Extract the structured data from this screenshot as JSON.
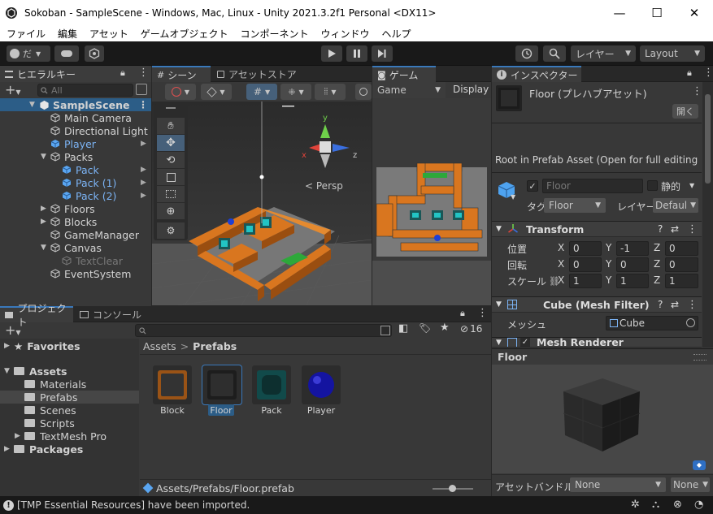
{
  "window": {
    "title": "Sokoban - SampleScene - Windows, Mac, Linux - Unity 2021.3.2f1 Personal <DX11>",
    "minimize": "—",
    "maximize": "☐",
    "close": "✕"
  },
  "menu": [
    "ファイル",
    "編集",
    "アセット",
    "ゲームオブジェクト",
    "コンポーネント",
    "ウィンドウ",
    "ヘルプ"
  ],
  "toolbar": {
    "account": "だ",
    "layers": "レイヤー",
    "layout": "Layout"
  },
  "hierarchy": {
    "tab": "ヒエラルキー",
    "search_placeholder": "All",
    "items": [
      {
        "label": "SampleScene",
        "depth": 0
      },
      {
        "label": "Main Camera",
        "depth": 1
      },
      {
        "label": "Directional Light",
        "depth": 1
      },
      {
        "label": "Player",
        "depth": 1
      },
      {
        "label": "Packs",
        "depth": 1
      },
      {
        "label": "Pack",
        "depth": 2
      },
      {
        "label": "Pack (1)",
        "depth": 2
      },
      {
        "label": "Pack (2)",
        "depth": 2
      },
      {
        "label": "Floors",
        "depth": 1
      },
      {
        "label": "Blocks",
        "depth": 1
      },
      {
        "label": "GameManager",
        "depth": 1
      },
      {
        "label": "Canvas",
        "depth": 1
      },
      {
        "label": "TextClear",
        "depth": 2
      },
      {
        "label": "EventSystem",
        "depth": 1
      }
    ]
  },
  "scene": {
    "tab": "シーン",
    "tab2": "アセットストア",
    "persp": "Persp",
    "axis_x": "x",
    "axis_y": "y",
    "axis_z": "z"
  },
  "game": {
    "tab": "ゲーム",
    "display_mode": "Game",
    "display": "Display"
  },
  "project": {
    "tab": "プロジェクト",
    "tab2": "コンソール",
    "hidden_count": "16",
    "favorites": "Favorites",
    "assets": "Assets",
    "folders": [
      "Materials",
      "Prefabs",
      "Scenes",
      "Scripts",
      "TextMesh Pro"
    ],
    "packages": "Packages",
    "breadcrumb_root": "Assets",
    "breadcrumb_sep": ">",
    "breadcrumb_current": "Prefabs",
    "items": [
      "Block",
      "Floor",
      "Pack",
      "Player"
    ],
    "path": "Assets/Prefabs/Floor.prefab"
  },
  "inspector": {
    "tab": "インスペクター",
    "title": "Floor (プレハブアセット)",
    "open_btn": "開く",
    "notice": "Root in Prefab Asset (Open for full editing s",
    "name": "Floor",
    "static": "静的",
    "tag_label": "タグ",
    "tag": "Floor",
    "layer_label": "レイヤー",
    "layer": "Defaul",
    "transform": "Transform",
    "pos_label": "位置",
    "rot_label": "回転",
    "scale_label": "スケール",
    "pos": [
      "0",
      "-1",
      "0"
    ],
    "rot": [
      "0",
      "0",
      "0"
    ],
    "scale": [
      "1",
      "1",
      "1"
    ],
    "mesh_filter": "Cube (Mesh Filter)",
    "mesh_label": "メッシュ",
    "mesh": "Cube",
    "mesh_renderer": "Mesh Renderer",
    "preview_title": "Floor",
    "bundle_label": "アセットバンドル",
    "bundle": "None",
    "bundle_variant": "None"
  },
  "status": {
    "message": "[TMP Essential Resources] have been imported."
  },
  "colors": {
    "accent": "#3a79bb",
    "selection": "#2c5d87",
    "orange": "#d9761f",
    "teal": "#22c4c4",
    "blue_text": "#7cb4f5"
  }
}
